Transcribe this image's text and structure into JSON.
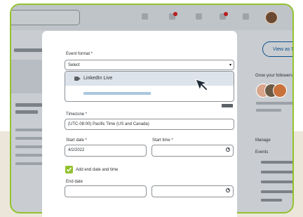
{
  "modal": {
    "event_format": {
      "label": "Event format *",
      "value": "Select",
      "option": "LinkedIn Live"
    },
    "timezone": {
      "label": "Timezone *",
      "value": "(UTC-08:00) Pacific Time (US and Canada)"
    },
    "start_date": {
      "label": "Start date *",
      "value": "4/2/2022"
    },
    "start_time": {
      "label": "Start time *",
      "value": ""
    },
    "add_end": {
      "label": "Add end date and time",
      "checked": true
    },
    "end_date": {
      "label": "End date",
      "value": ""
    },
    "end_time": {
      "value": ""
    }
  },
  "background": {
    "view_as_button": "View as Me",
    "grow_text": "Grow your followers",
    "manage_label": "Manage",
    "events_label": "Events"
  },
  "colors": {
    "accent": "#93c22f",
    "brand_blue": "#0a4f8a",
    "notification": "#b51f1f"
  },
  "icons": [
    "video-camera-icon",
    "mouse-cursor-icon",
    "clock-icon",
    "checkmark-icon",
    "dropdown-arrow-icon"
  ]
}
